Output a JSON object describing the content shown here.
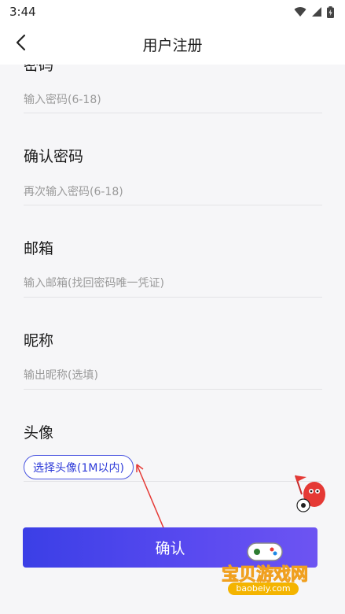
{
  "status_bar": {
    "time": "3:44"
  },
  "nav": {
    "title": "用户注册"
  },
  "form": {
    "password_label_partial": "密码",
    "password_placeholder": "输入密码(6-18)",
    "confirm_password_label": "确认密码",
    "confirm_password_placeholder": "再次输入密码(6-18)",
    "email_label": "邮箱",
    "email_placeholder": "输入邮箱(找回密码唯一凭证)",
    "nickname_label": "昵称",
    "nickname_placeholder": "输出昵称(选填)",
    "avatar_label": "头像",
    "avatar_button": "选择头像(1M以内)",
    "confirm_button": "确认"
  },
  "watermark": {
    "text": "宝贝游戏网",
    "url": "baobeiy.com"
  },
  "colors": {
    "accent": "#3b3fe6",
    "accent_end": "#6d54f2",
    "background": "#f6f6f8",
    "placeholder": "#9a9a9a"
  }
}
